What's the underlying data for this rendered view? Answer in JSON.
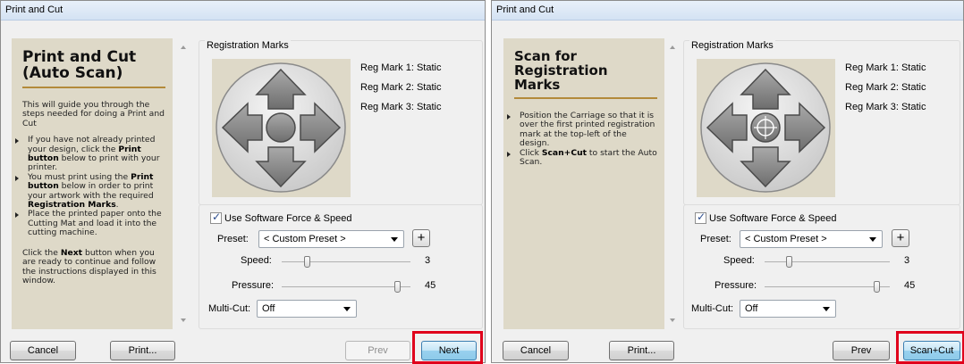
{
  "left": {
    "window_title": "Print and Cut",
    "guide_title": "Print and Cut\n(Auto Scan)",
    "guide_intro": "This will guide you through the steps needed for doing a Print and Cut",
    "bullets": [
      {
        "before": "If you have not already printed your design, click the ",
        "bold": "Print button",
        "after": " below to print with your printer."
      },
      {
        "before": "You must print using the ",
        "bold": "Print button",
        "after": " below in order to print your artwork with the required ",
        "bold2": "Registration Marks",
        "after2": "."
      },
      {
        "before": "Place the printed paper onto the Cutting Mat and load it into the cutting machine.",
        "bold": "",
        "after": ""
      }
    ],
    "footer_before": "Click the ",
    "footer_bold": "Next",
    "footer_after": " button when you are ready to continue and follow the instructions displayed in this window.",
    "reg_group_label": "Registration Marks",
    "reg_marks": [
      "Reg Mark 1:  Static",
      "Reg Mark 2:  Static",
      "Reg Mark 3:  Static"
    ],
    "pad_center": "circle",
    "use_software_label": "Use Software Force  & Speed",
    "preset_label": "Preset:",
    "preset_value": "< Custom Preset >",
    "speed_label": "Speed:",
    "speed_value": "3",
    "speed_level": 0.2,
    "pressure_label": "Pressure:",
    "pressure_value": "45",
    "pressure_level": 0.9,
    "multicut_label": "Multi-Cut:",
    "multicut_value": "Off",
    "buttons": {
      "cancel": "Cancel",
      "print": "Print...",
      "prev": "Prev",
      "next": "Next"
    }
  },
  "right": {
    "window_title": "Print and Cut",
    "guide_title": "Scan for\nRegistration Marks",
    "bullets": [
      {
        "before": "Position the Carriage so that it is over the first printed registration mark at the top-left of the design.",
        "bold": "",
        "after": ""
      },
      {
        "before": "Click ",
        "bold": "Scan+Cut",
        "after": " to start the Auto Scan."
      }
    ],
    "reg_group_label": "Registration Marks",
    "reg_marks": [
      "Reg Mark 1:  Static",
      "Reg Mark 2:  Static",
      "Reg Mark 3:  Static"
    ],
    "pad_center": "crosshair",
    "use_software_label": "Use Software Force  & Speed",
    "preset_label": "Preset:",
    "preset_value": "< Custom Preset >",
    "speed_label": "Speed:",
    "speed_value": "3",
    "speed_level": 0.2,
    "pressure_label": "Pressure:",
    "pressure_value": "45",
    "pressure_level": 0.9,
    "multicut_label": "Multi-Cut:",
    "multicut_value": "Off",
    "buttons": {
      "cancel": "Cancel",
      "print": "Print...",
      "prev": "Prev",
      "scancut": "Scan+Cut"
    }
  },
  "colors": {
    "highlight": "#e0001b",
    "guide_bg": "#ded9c8",
    "rule": "#b38a3a"
  }
}
